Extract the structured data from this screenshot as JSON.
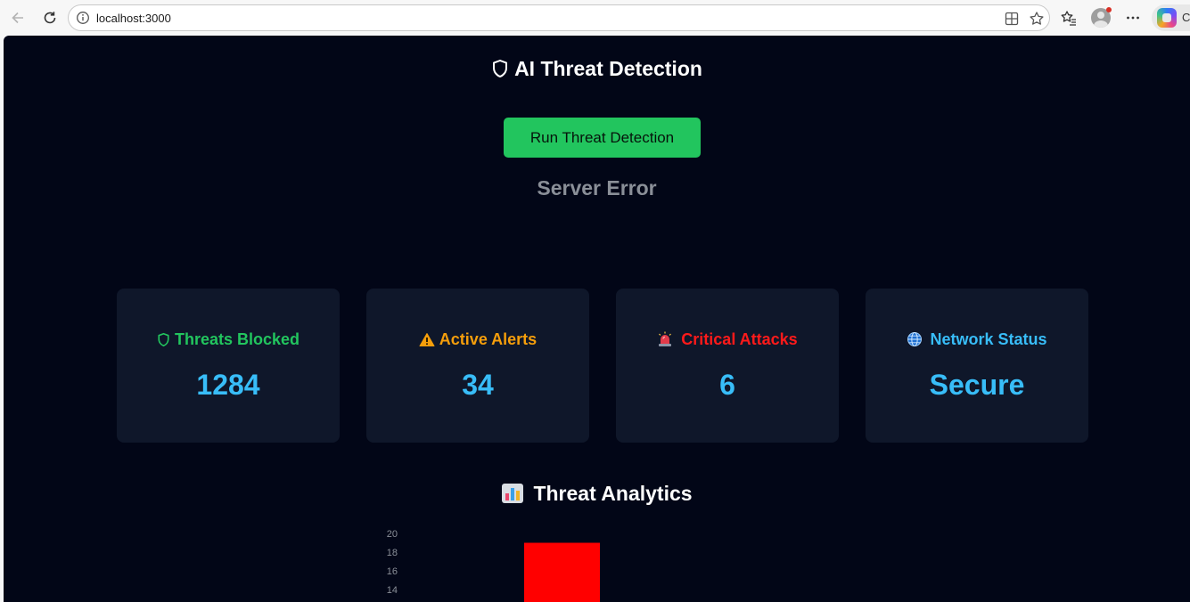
{
  "browser": {
    "url": "localhost:3000",
    "copilot_label": "C",
    "icons": {
      "back": "back-arrow-icon",
      "reload": "reload-icon",
      "info": "info-icon",
      "split_screen": "split-screen-icon",
      "favorite": "star-icon",
      "favorites": "favorites-icon",
      "profile": "profile-avatar-icon",
      "more": "more-icon",
      "copilot": "copilot-icon"
    }
  },
  "page": {
    "title": "AI Threat Detection",
    "title_icon": "shield-icon",
    "run_button_label": "Run Threat Detection",
    "status_message": "Server Error",
    "colors": {
      "background": "#020617",
      "card": "#0f172a",
      "run_button": "#22c55e",
      "value": "#38bdf8",
      "status": "#8a8f98"
    }
  },
  "cards": [
    {
      "label": "Threats Blocked",
      "value": "1284",
      "icon": "shield-icon",
      "color": "#22c55e"
    },
    {
      "label": "Active Alerts",
      "value": "34",
      "icon": "warning-icon",
      "color": "#f59e0b"
    },
    {
      "label": "Critical Attacks",
      "value": "6",
      "icon": "siren-icon",
      "color": "#ff1a1a"
    },
    {
      "label": "Network Status",
      "value": "Secure",
      "icon": "globe-icon",
      "color": "#38bdf8"
    }
  ],
  "analytics": {
    "title": "Threat Analytics",
    "icon": "bar-chart-icon"
  },
  "chart_data": {
    "type": "bar",
    "y_ticks": [
      "20",
      "18",
      "16",
      "14"
    ],
    "ylim_visible": [
      13,
      20
    ],
    "bars": [
      {
        "value": 19,
        "color": "#ff0000"
      }
    ],
    "note_visible": ""
  }
}
